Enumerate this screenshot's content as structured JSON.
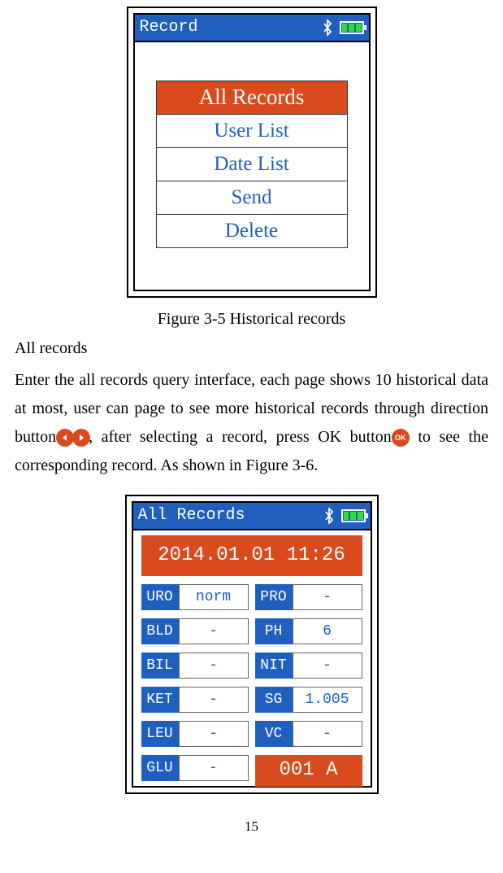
{
  "screen1": {
    "title": "Record",
    "menu": {
      "items": [
        {
          "label": "All Records",
          "selected": true
        },
        {
          "label": "User List",
          "selected": false
        },
        {
          "label": "Date List",
          "selected": false
        },
        {
          "label": "Send",
          "selected": false
        },
        {
          "label": "Delete",
          "selected": false
        }
      ]
    }
  },
  "figure_caption": "Figure 3-5 Historical records",
  "subheading": "All records",
  "paragraph": {
    "part1": "Enter the all records query interface, each page shows 10 historical data at most, user can page to see more historical records through direction button",
    "part2": ", after selecting a record, press OK button",
    "part3": " to see the corresponding record. As shown in Figure 3-6."
  },
  "ok_label": "OK",
  "screen2": {
    "title": "All Records",
    "timestamp": "2014.01.01 11:26",
    "params": [
      {
        "lbl": "URO",
        "val": "norm"
      },
      {
        "lbl": "PRO",
        "val": "-"
      },
      {
        "lbl": "BLD",
        "val": "-"
      },
      {
        "lbl": "PH",
        "val": "6"
      },
      {
        "lbl": "BIL",
        "val": "-"
      },
      {
        "lbl": "NIT",
        "val": "-"
      },
      {
        "lbl": "KET",
        "val": "-"
      },
      {
        "lbl": "SG",
        "val": "1.005"
      },
      {
        "lbl": "LEU",
        "val": "-"
      },
      {
        "lbl": "VC",
        "val": "-"
      },
      {
        "lbl": "GLU",
        "val": "-"
      }
    ],
    "record_id": "001 A"
  },
  "page_number": "15"
}
